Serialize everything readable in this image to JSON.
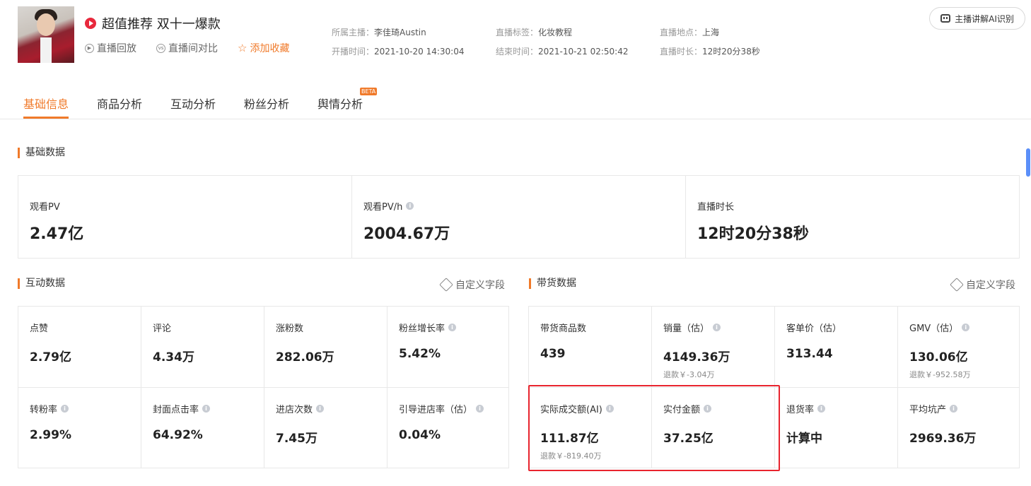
{
  "header": {
    "title": "超值推荐 双十一爆款",
    "actions": [
      {
        "label": "直播回放",
        "icon": "replay-icon"
      },
      {
        "label": "直播间对比",
        "icon": "vs-icon"
      },
      {
        "label": "添加收藏",
        "icon": "star-icon"
      }
    ],
    "meta": {
      "anchor_label": "所属主播：",
      "anchor_value": "李佳琦Austin",
      "start_label": "开播时间：",
      "start_value": "2021-10-20 14:30:04",
      "tag_label": "直播标签：",
      "tag_value": "化妆教程",
      "end_label": "结束时间：",
      "end_value": "2021-10-21 02:50:42",
      "place_label": "直播地点：",
      "place_value": "上海",
      "duration_label": "直播时长：",
      "duration_value": "12时20分38秒"
    },
    "ai_button": "主播讲解AI识别"
  },
  "tabs": [
    {
      "label": "基础信息",
      "active": true
    },
    {
      "label": "商品分析",
      "active": false
    },
    {
      "label": "互动分析",
      "active": false
    },
    {
      "label": "粉丝分析",
      "active": false
    },
    {
      "label": "舆情分析",
      "active": false,
      "badge": "BETA"
    }
  ],
  "basic": {
    "title": "基础数据",
    "items": [
      {
        "label": "观看PV",
        "value": "2.47亿"
      },
      {
        "label": "观看PV/h",
        "value": "2004.67万"
      },
      {
        "label": "直播时长",
        "value": "12时20分38秒"
      }
    ]
  },
  "interaction": {
    "title": "互动数据",
    "custom": "自定义字段",
    "items": [
      {
        "label": "点赞",
        "value": "2.79亿"
      },
      {
        "label": "评论",
        "value": "4.34万"
      },
      {
        "label": "涨粉数",
        "value": "282.06万"
      },
      {
        "label": "粉丝增长率",
        "value": "5.42%"
      },
      {
        "label": "转粉率",
        "value": "2.99%"
      },
      {
        "label": "封面点击率",
        "value": "64.92%"
      },
      {
        "label": "进店次数",
        "value": "7.45万"
      },
      {
        "label": "引导进店率（估）",
        "value": "0.04%"
      }
    ]
  },
  "sales": {
    "title": "带货数据",
    "custom": "自定义字段",
    "items": [
      {
        "label": "带货商品数",
        "value": "439"
      },
      {
        "label": "销量（估）",
        "value": "4149.36万",
        "sub": "退款￥-3.04万"
      },
      {
        "label": "客单价（估）",
        "value": "313.44"
      },
      {
        "label": "GMV（估）",
        "value": "130.06亿",
        "sub": "退款￥-952.58万"
      },
      {
        "label": "实际成交额(AI)",
        "value": "111.87亿",
        "sub": "退款￥-819.40万"
      },
      {
        "label": "实付金额",
        "value": "37.25亿"
      },
      {
        "label": "退货率",
        "value": "计算中"
      },
      {
        "label": "平均坑产",
        "value": "2969.36万"
      }
    ]
  },
  "colors": {
    "accent": "#f07a2a",
    "highlight": "#e8242e"
  }
}
